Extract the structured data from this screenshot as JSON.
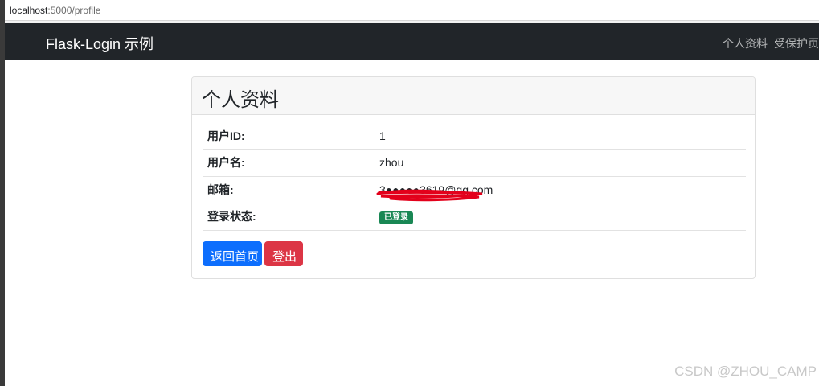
{
  "browser": {
    "host": "localhost",
    "path": ":5000/profile"
  },
  "navbar": {
    "brand": "Flask-Login 示例",
    "links": [
      "个人资料",
      "受保护页"
    ]
  },
  "card": {
    "title": "个人资料",
    "rows": [
      {
        "label": "用户ID:",
        "value": "1"
      },
      {
        "label": "用户名:",
        "value": "zhou"
      },
      {
        "label": "邮箱:",
        "value": "3●●●●●3619@qq.com"
      },
      {
        "label": "登录状态:",
        "value": "已登录"
      }
    ],
    "buttons": {
      "home": "返回首页",
      "logout": "登出"
    }
  },
  "colors": {
    "navbar_bg": "#212529",
    "primary": "#0d6efd",
    "danger": "#dc3545",
    "success": "#198754",
    "redaction": "#e3001b"
  },
  "watermark": "CSDN @ZHOU_CAMP"
}
